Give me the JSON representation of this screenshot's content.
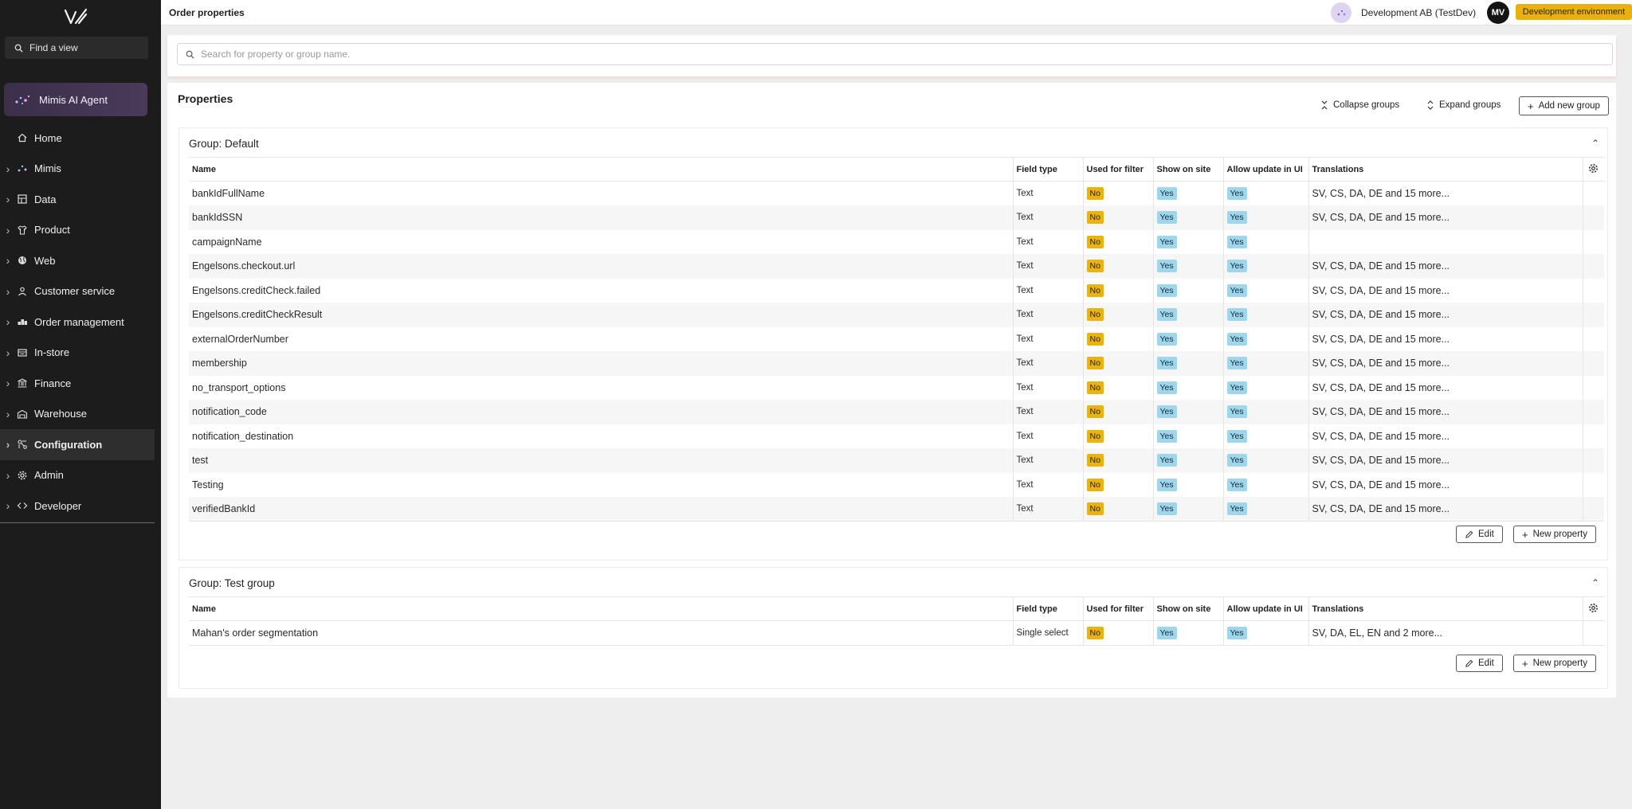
{
  "sidebar": {
    "search_label": "Find a view",
    "agent_label": "Mimis AI Agent",
    "items": [
      {
        "label": "Home",
        "icon": "home-icon",
        "has_chevron": false
      },
      {
        "label": "Mimis",
        "icon": "sparkle-icon",
        "has_chevron": true
      },
      {
        "label": "Data",
        "icon": "data-icon",
        "has_chevron": true
      },
      {
        "label": "Product",
        "icon": "shirt-icon",
        "has_chevron": true
      },
      {
        "label": "Web",
        "icon": "globe-icon",
        "has_chevron": true
      },
      {
        "label": "Customer service",
        "icon": "person-icon",
        "has_chevron": true
      },
      {
        "label": "Order management",
        "icon": "boxes-icon",
        "has_chevron": true
      },
      {
        "label": "In-store",
        "icon": "register-icon",
        "has_chevron": true
      },
      {
        "label": "Finance",
        "icon": "bank-icon",
        "has_chevron": true
      },
      {
        "label": "Warehouse",
        "icon": "warehouse-icon",
        "has_chevron": true
      },
      {
        "label": "Configuration",
        "icon": "config-icon",
        "has_chevron": true,
        "active": true
      },
      {
        "label": "Admin",
        "icon": "gear-icon",
        "has_chevron": true
      },
      {
        "label": "Developer",
        "icon": "code-icon",
        "has_chevron": true
      }
    ]
  },
  "header": {
    "title": "Order properties",
    "org_name": "Development AB (TestDev)",
    "avatar_initials": "MV",
    "env_badge": "Development environment"
  },
  "search": {
    "placeholder": "Search for property or group name."
  },
  "properties": {
    "title": "Properties",
    "collapse_label": "Collapse groups",
    "expand_label": "Expand groups",
    "add_group_label": "Add new group",
    "columns": [
      "Name",
      "Field type",
      "Used for filter",
      "Show on site",
      "Allow update in UI",
      "Translations"
    ],
    "edit_label": "Edit",
    "new_property_label": "New property",
    "groups": [
      {
        "title": "Group: Default",
        "rows": [
          {
            "name": "bankIdFullName",
            "field_type": "Text",
            "used_for_filter": "No",
            "show_on_site": "Yes",
            "allow_update": "Yes",
            "translations": "SV, CS, DA, DE and 15 more..."
          },
          {
            "name": "bankIdSSN",
            "field_type": "Text",
            "used_for_filter": "No",
            "show_on_site": "Yes",
            "allow_update": "Yes",
            "translations": "SV, CS, DA, DE and 15 more..."
          },
          {
            "name": "campaignName",
            "field_type": "Text",
            "used_for_filter": "No",
            "show_on_site": "Yes",
            "allow_update": "Yes",
            "translations": ""
          },
          {
            "name": "Engelsons.checkout.url",
            "field_type": "Text",
            "used_for_filter": "No",
            "show_on_site": "Yes",
            "allow_update": "Yes",
            "translations": "SV, CS, DA, DE and 15 more..."
          },
          {
            "name": "Engelsons.creditCheck.failed",
            "field_type": "Text",
            "used_for_filter": "No",
            "show_on_site": "Yes",
            "allow_update": "Yes",
            "translations": "SV, CS, DA, DE and 15 more..."
          },
          {
            "name": "Engelsons.creditCheckResult",
            "field_type": "Text",
            "used_for_filter": "No",
            "show_on_site": "Yes",
            "allow_update": "Yes",
            "translations": "SV, CS, DA, DE and 15 more..."
          },
          {
            "name": "externalOrderNumber",
            "field_type": "Text",
            "used_for_filter": "No",
            "show_on_site": "Yes",
            "allow_update": "Yes",
            "translations": "SV, CS, DA, DE and 15 more..."
          },
          {
            "name": "membership",
            "field_type": "Text",
            "used_for_filter": "No",
            "show_on_site": "Yes",
            "allow_update": "Yes",
            "translations": "SV, CS, DA, DE and 15 more..."
          },
          {
            "name": "no_transport_options",
            "field_type": "Text",
            "used_for_filter": "No",
            "show_on_site": "Yes",
            "allow_update": "Yes",
            "translations": "SV, CS, DA, DE and 15 more..."
          },
          {
            "name": "notification_code",
            "field_type": "Text",
            "used_for_filter": "No",
            "show_on_site": "Yes",
            "allow_update": "Yes",
            "translations": "SV, CS, DA, DE and 15 more..."
          },
          {
            "name": "notification_destination",
            "field_type": "Text",
            "used_for_filter": "No",
            "show_on_site": "Yes",
            "allow_update": "Yes",
            "translations": "SV, CS, DA, DE and 15 more..."
          },
          {
            "name": "test",
            "field_type": "Text",
            "used_for_filter": "No",
            "show_on_site": "Yes",
            "allow_update": "Yes",
            "translations": "SV, CS, DA, DE and 15 more..."
          },
          {
            "name": "Testing",
            "field_type": "Text",
            "used_for_filter": "No",
            "show_on_site": "Yes",
            "allow_update": "Yes",
            "translations": "SV, CS, DA, DE and 15 more..."
          },
          {
            "name": "verifiedBankId",
            "field_type": "Text",
            "used_for_filter": "No",
            "show_on_site": "Yes",
            "allow_update": "Yes",
            "translations": "SV, CS, DA, DE and 15 more..."
          }
        ]
      },
      {
        "title": "Group: Test group",
        "rows": [
          {
            "name": "Mahan's order segmentation",
            "field_type": "Single select",
            "used_for_filter": "No",
            "show_on_site": "Yes",
            "allow_update": "Yes",
            "translations": "SV, DA, EL, EN and 2 more..."
          }
        ]
      }
    ]
  },
  "colors": {
    "sidebar_bg": "#1c1c1c",
    "no_badge": "#e9b413",
    "yes_badge": "#9fd6ec",
    "env_badge": "#e8b10d"
  }
}
